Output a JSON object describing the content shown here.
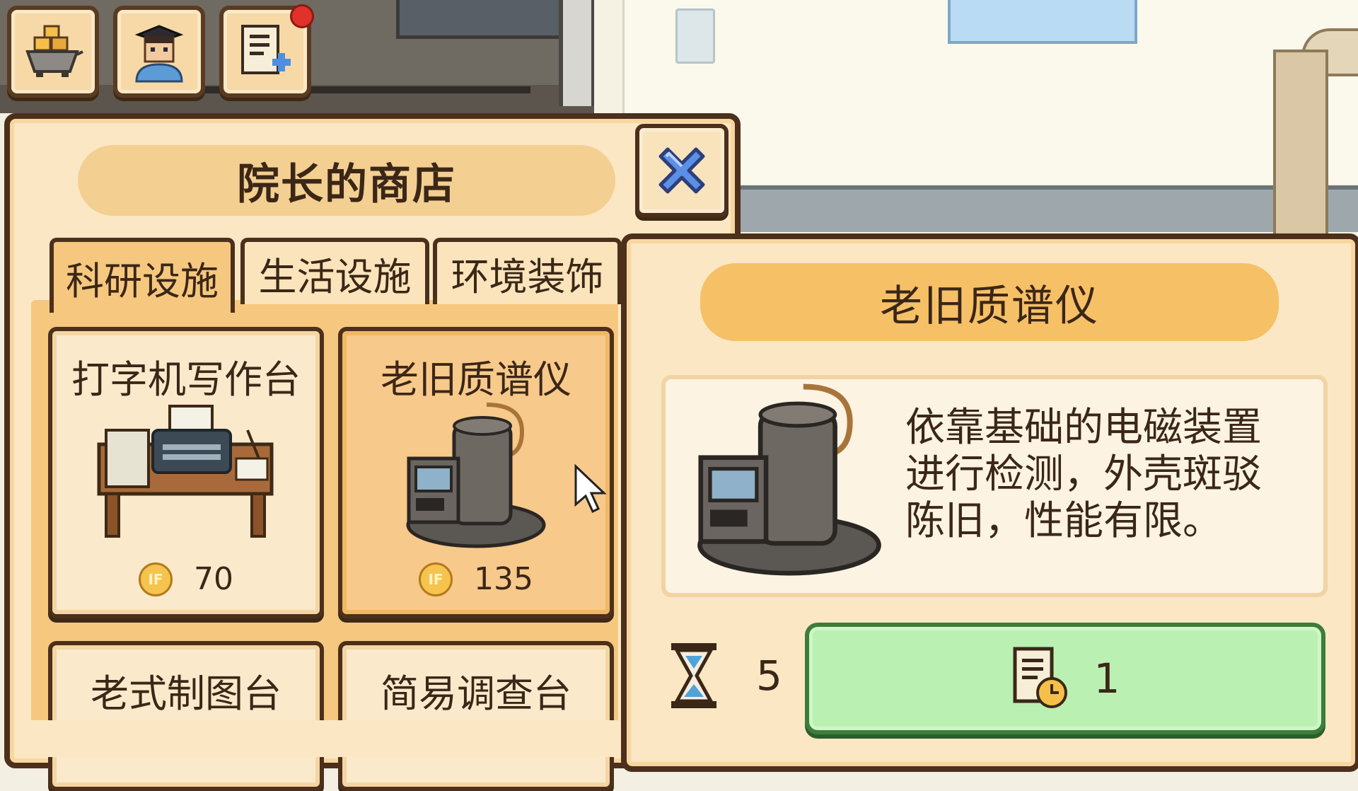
{
  "shop": {
    "title": "院长的商店",
    "tabs": [
      {
        "label": "科研设施",
        "active": true
      },
      {
        "label": "生活设施",
        "active": false
      },
      {
        "label": "环境装饰",
        "active": false
      }
    ],
    "items": [
      {
        "name": "打字机写作台",
        "price": "70",
        "coin_label": "IF"
      },
      {
        "name": "老旧质谱仪",
        "price": "135",
        "coin_label": "IF",
        "selected": true
      },
      {
        "name": "老式制图台"
      },
      {
        "name": "简易调查台"
      }
    ]
  },
  "detail": {
    "title": "老旧质谱仪",
    "description": "依靠基础的电磁装置进行检测，外壳斑驳陈旧，性能有限。",
    "build_time": "5",
    "build_cost": "1"
  },
  "icons": {
    "top_buttons": [
      "resources-icon",
      "staff-icon",
      "tasks-icon"
    ],
    "close": "close-icon",
    "time": "hourglass-icon",
    "cost": "document-clock-icon"
  },
  "colors": {
    "panel": "#fbe7c3",
    "border": "#4c301b",
    "accent": "#f6c066",
    "build_button": "#bbf0b3",
    "notification": "#e0322a"
  }
}
